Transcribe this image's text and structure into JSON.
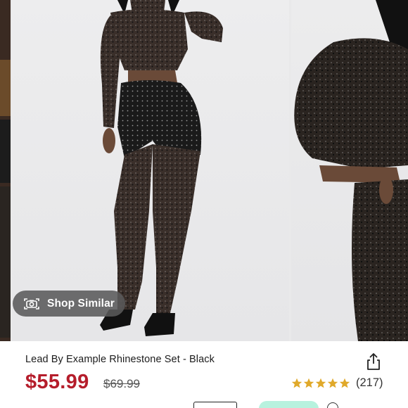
{
  "carousel": {
    "shop_similar_label": "Shop Similar",
    "icons": {
      "camera": "camera-scan-icon"
    }
  },
  "product": {
    "title": "Lead By Example Rhinestone Set - Black",
    "price": "$55.99",
    "original_price": "$69.99",
    "rating_value": 5,
    "rating_count": "(217)",
    "share_icon": "share-icon"
  },
  "colors": {
    "price_red": "#b51d2b",
    "star_gold": "#e0a92a",
    "pill_bg": "#5a5a5a",
    "afterpay_mint": "#b7f2de"
  }
}
